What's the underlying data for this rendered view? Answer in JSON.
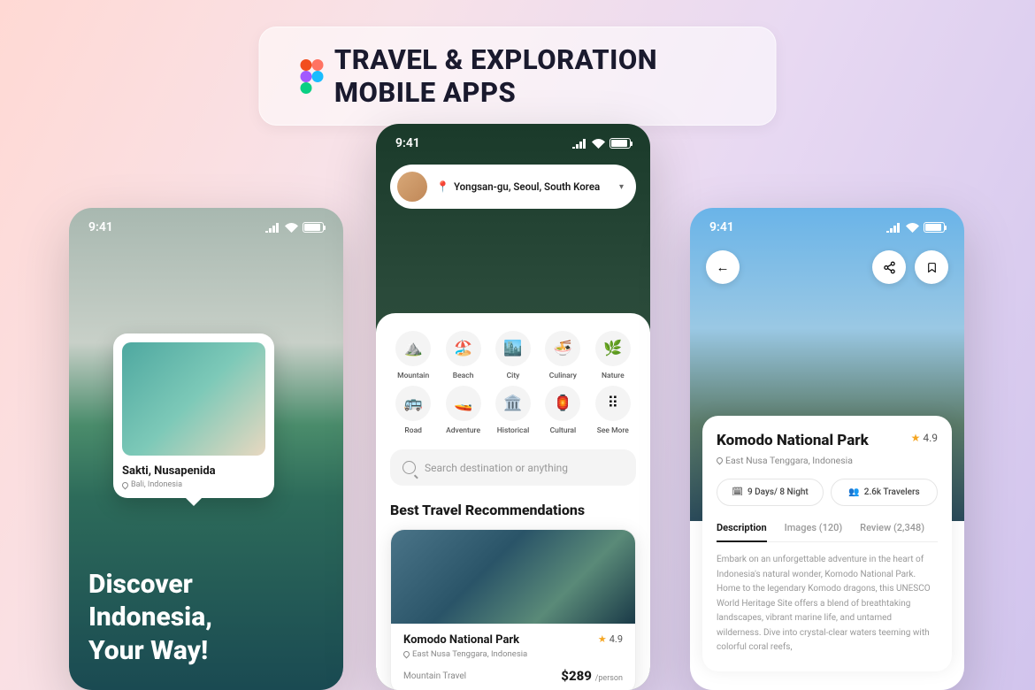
{
  "banner": {
    "title": "TRAVEL & EXPLORATION MOBILE APPS"
  },
  "statusbar": {
    "time": "9:41"
  },
  "screen1": {
    "place_card": {
      "name": "Sakti, Nusapenida",
      "location": "Bali, Indonesia"
    },
    "hero_text": "Discover\nIndonesia,\nYour Way!"
  },
  "screen2": {
    "location_bar": {
      "text": "Yongsan-gu, Seoul, South Korea"
    },
    "categories": [
      {
        "icon": "⛰️",
        "label": "Mountain"
      },
      {
        "icon": "🏖️",
        "label": "Beach"
      },
      {
        "icon": "🏙️",
        "label": "City"
      },
      {
        "icon": "🍜",
        "label": "Culinary"
      },
      {
        "icon": "🌿",
        "label": "Nature"
      },
      {
        "icon": "🚌",
        "label": "Road"
      },
      {
        "icon": "🚤",
        "label": "Adventure"
      },
      {
        "icon": "🏛️",
        "label": "Historical"
      },
      {
        "icon": "🏮",
        "label": "Cultural"
      },
      {
        "icon": "⠿",
        "label": "See More"
      }
    ],
    "search_placeholder": "Search destination or anything",
    "section_title": "Best Travel Recommendations",
    "rec": {
      "name": "Komodo National Park",
      "rating": "4.9",
      "location": "East Nusa Tenggara, Indonesia",
      "type": "Mountain Travel",
      "price": "$289",
      "per": "/person"
    }
  },
  "screen3": {
    "title": "Komodo National Park",
    "rating": "4.9",
    "location": "East Nusa Tenggara, Indonesia",
    "pill_duration": "9 Days/ 8 Night",
    "pill_travelers": "2.6k Travelers",
    "tabs": [
      {
        "label": "Description",
        "active": true
      },
      {
        "label": "Images (120)",
        "active": false
      },
      {
        "label": "Review (2,348)",
        "active": false
      }
    ],
    "description": "Embark on an unforgettable adventure in the heart of Indonesia's natural wonder, Komodo National Park. Home to the legendary Komodo dragons, this UNESCO World Heritage Site offers a blend of breathtaking landscapes, vibrant marine life, and untamed wilderness. Dive into crystal-clear waters teeming with colorful coral reefs,"
  }
}
